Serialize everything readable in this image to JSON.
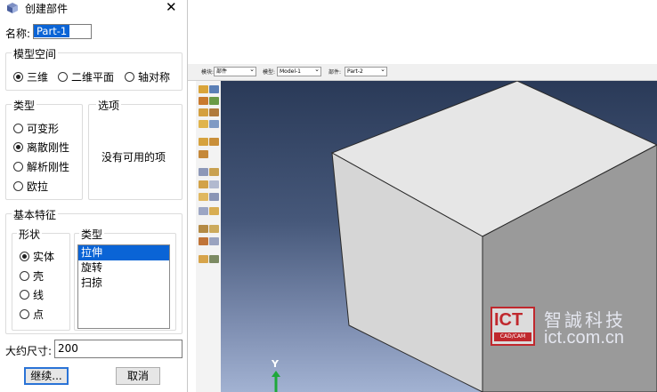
{
  "dialog": {
    "title": "创建部件",
    "name_label": "名称:",
    "name_value": "Part-1",
    "modeling_space": {
      "legend": "模型空间",
      "options": [
        "三维",
        "二维平面",
        "轴对称"
      ],
      "selected": "三维"
    },
    "type_group": {
      "legend": "类型",
      "options": [
        "可变形",
        "离散刚性",
        "解析刚性",
        "欧拉"
      ],
      "selected": "离散刚性"
    },
    "options_group": {
      "legend": "选项",
      "empty_text": "没有可用的项"
    },
    "base_feature": {
      "legend": "基本特征",
      "shape": {
        "legend": "形状",
        "options": [
          "实体",
          "壳",
          "线",
          "点"
        ],
        "selected": "实体"
      },
      "type": {
        "legend": "类型",
        "items": [
          "拉伸",
          "旋转",
          "扫掠"
        ],
        "selected": "拉伸"
      }
    },
    "approx_size_label": "大约尺寸:",
    "approx_size_value": "200",
    "continue_button": "继续...",
    "cancel_button": "取消"
  },
  "context_bar": {
    "module_label": "模块:",
    "module_value": "部件",
    "model_label": "模型:",
    "model_value": "Model-1",
    "part_label": "部件:",
    "part_value": "Part-2"
  },
  "viewport": {
    "axis_y_label": "Y",
    "background_top": "#2a3a58",
    "background_bottom": "#a2b2d2"
  },
  "watermark": {
    "logo_text": "ICT",
    "logo_sub": "CAD/CAM",
    "chinese": "智誠科技",
    "url": "ict.com.cn"
  }
}
